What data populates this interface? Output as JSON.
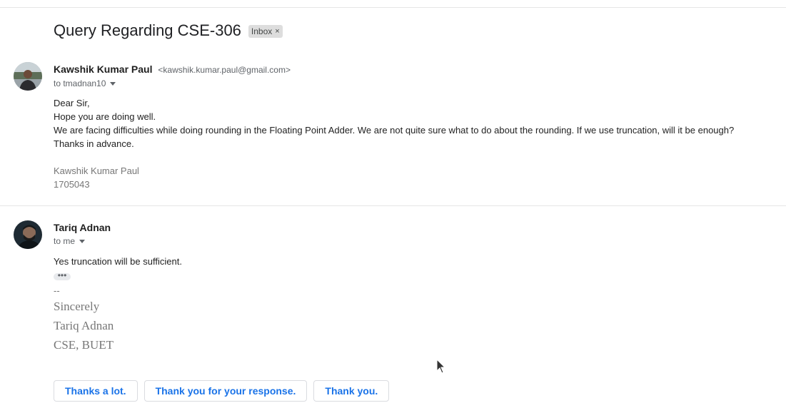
{
  "thread": {
    "subject": "Query Regarding CSE-306",
    "label": "Inbox",
    "label_remove": "×"
  },
  "messages": [
    {
      "sender_name": "Kawshik Kumar Paul",
      "sender_email": "<kawshik.kumar.paul@gmail.com>",
      "to": "to tmadnan10",
      "body_lines": [
        "Dear Sir,",
        "Hope you are doing well.",
        "We are facing difficulties while doing rounding in the Floating Point Adder. We are not quite sure what to do about the rounding. If we use truncation, will it be enough?",
        "Thanks in advance."
      ],
      "signature": [
        "Kawshik Kumar Paul",
        "1705043"
      ]
    },
    {
      "sender_name": "Tariq Adnan",
      "to": "to me",
      "body_lines": [
        "Yes truncation will be sufficient."
      ],
      "ellipsis": "•••",
      "dash": "--",
      "signature": [
        "Sincerely",
        "Tariq Adnan",
        "CSE, BUET"
      ]
    }
  ],
  "smart_replies": [
    "Thanks a lot.",
    "Thank you for your response.",
    "Thank you."
  ],
  "icons": {
    "caret": "chevron-down-icon",
    "cursor": "mouse-pointer-icon"
  },
  "colors": {
    "accent": "#1a73e8",
    "chip_bg": "#dddddd",
    "divider": "#e6e6e6"
  }
}
